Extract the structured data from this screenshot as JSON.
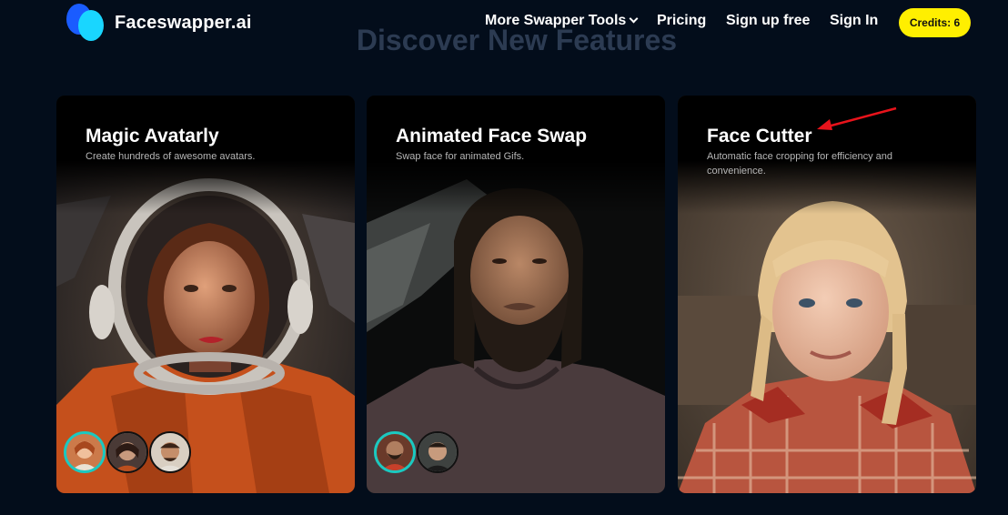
{
  "header": {
    "brand": "Faceswapper.ai",
    "nav": {
      "tools": "More Swapper Tools",
      "pricing": "Pricing",
      "signup": "Sign up free",
      "signin": "Sign In"
    },
    "credits": "Credits: 6"
  },
  "section": {
    "title": "Discover New Features"
  },
  "cards": [
    {
      "title": "Magic Avatarly",
      "description": "Create hundreds of awesome avatars."
    },
    {
      "title": "Animated Face Swap",
      "description": "Swap face for animated Gifs."
    },
    {
      "title": "Face Cutter",
      "description": "Automatic face cropping for efficiency and convenience."
    }
  ],
  "colors": {
    "background": "#030d1b",
    "credits_badge": "#ffef00",
    "avatar_active_ring": "#1bc9c0",
    "annotation_arrow": "#e8131b"
  },
  "icons": {
    "brand": "faceswapper-logo-icon",
    "dropdown": "chevron-down-icon",
    "annotation": "red-arrow-icon"
  }
}
